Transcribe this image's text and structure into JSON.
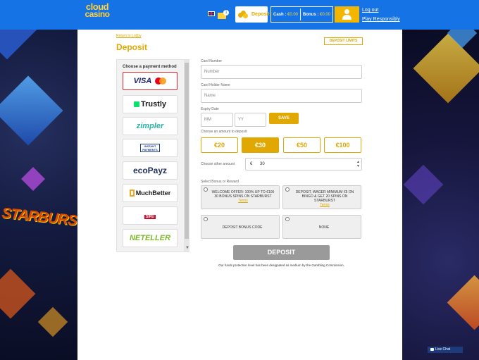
{
  "header": {
    "logo_line1": "cloud",
    "logo_line2": "casino",
    "deposit_label": "Deposit",
    "cash_label": "Cash :",
    "cash_value": "€0.00",
    "bonus_label": "Bonus :",
    "bonus_value": "€0.00",
    "logout_label": "Log out",
    "responsibly_label": "Play Responsibly",
    "mail_count": "1"
  },
  "page": {
    "return_link": "Return to Lobby",
    "title": "Deposit",
    "limits_button": "DEPOSIT LIMITS"
  },
  "methods": {
    "caption": "Choose a payment method",
    "items": [
      {
        "label": "VISA",
        "color": "#1a1f71"
      },
      {
        "label": "Trustly",
        "color": "#1a1a1a"
      },
      {
        "label": "zimpler",
        "color": "#2bb3a3"
      },
      {
        "label": "INSTANT PAYMENTS",
        "color": "#1d3d8f"
      },
      {
        "label": "ecoPayz",
        "color": "#1f2f5a"
      },
      {
        "label": "MuchBetter",
        "color": "#1a1a1a"
      },
      {
        "label": "SIRU",
        "color": "#c8102e"
      },
      {
        "label": "NETELLER",
        "color": "#7ab929"
      }
    ]
  },
  "form": {
    "card_number_label": "Card Number",
    "card_number_placeholder": "Number",
    "holder_label": "Card Holder Name",
    "holder_placeholder": "Name",
    "expiry_label": "Expiry Date",
    "mm_placeholder": "MM",
    "yy_placeholder": "YY",
    "save_label": "SAVE",
    "amount_label": "Choose an amount to deposit",
    "amounts": [
      "€20",
      "€30",
      "€50",
      "€100"
    ],
    "selected_amount": "€30",
    "other_label": "Choose other amount",
    "currency_symbol": "€",
    "other_value": "30",
    "bonus_label": "Select Bonus or Reward",
    "bonus_1_text": "WELCOME OFFER: 100% UP TO €100 30 BONUS SPINS ON STARBURST",
    "bonus_2_text": "DEPOSIT, WAGER MINIMUM €5 ON BINGO & GET 20 SPINS ON STARBURST",
    "terms_label": "Terms",
    "bonus_code_label": "DEPOSIT BONUS CODE",
    "none_label": "NONE",
    "deposit_button": "DEPOSIT",
    "footnote": "Our funds protection level has been designated as medium by the Gambling Commission."
  },
  "art": {
    "starburst_text": "STARBURST"
  },
  "chat": {
    "label": "Live Chat"
  }
}
